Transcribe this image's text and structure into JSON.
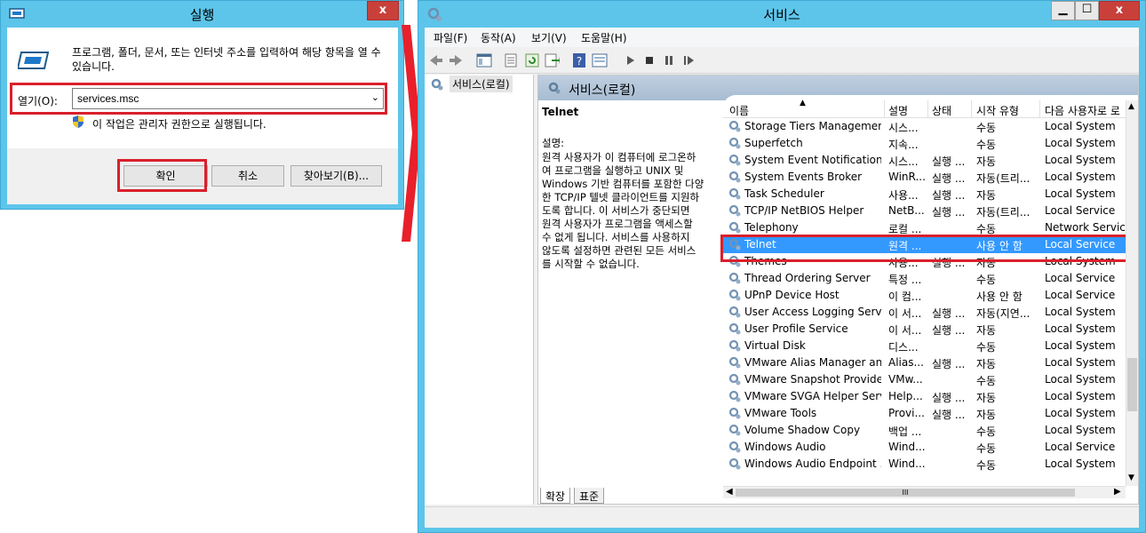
{
  "run": {
    "title": "실행",
    "close": "x",
    "description": "프로그램, 폴더, 문서, 또는 인터넷 주소를 입력하여 해당 항목을 열 수 있습니다.",
    "open_label": "열기(O):",
    "input_value": "services.msc",
    "admin_note": "이 작업은 관리자 권한으로 실행됩니다.",
    "ok": "확인",
    "cancel": "취소",
    "browse": "찾아보기(B)..."
  },
  "services": {
    "title": "서비스",
    "close": "x",
    "minimize": "▁",
    "maximize": "☐",
    "menu": [
      "파일(F)",
      "동작(A)",
      "보기(V)",
      "도움말(H)"
    ],
    "tree_item": "서비스(로컬)",
    "pane_title": "서비스(로컬)",
    "detail_name": "Telnet",
    "detail_label": "설명:",
    "detail_lines": [
      "원격 사용자가 이 컴퓨터에 로그온하",
      "여 프로그램을 실행하고 UNIX 및",
      "Windows 기반 컴퓨터를 포함한 다양",
      "한 TCP/IP 텔넷 클라이언트를 지원하",
      "도록 합니다. 이 서비스가 중단되면",
      "원격 사용자가 프로그램을 액세스할",
      "수 없게 됩니다. 서비스를 사용하지",
      "않도록 설정하면 관련된 모든 서비스",
      "를 시작할 수 없습니다."
    ],
    "columns": [
      "이름",
      "설명",
      "상태",
      "시작 유형",
      "다음 사용자로 로"
    ],
    "rows": [
      [
        "Storage Tiers Management",
        "시스...",
        "",
        "수동",
        "Local System"
      ],
      [
        "Superfetch",
        "지속...",
        "",
        "수동",
        "Local System"
      ],
      [
        "System Event Notification ...",
        "시스...",
        "실행 ...",
        "자동",
        "Local System"
      ],
      [
        "System Events Broker",
        "WinR...",
        "실행 ...",
        "자동(트리...",
        "Local System"
      ],
      [
        "Task Scheduler",
        "사용...",
        "실행 ...",
        "자동",
        "Local System"
      ],
      [
        "TCP/IP NetBIOS Helper",
        "NetB...",
        "실행 ...",
        "자동(트리...",
        "Local Service"
      ],
      [
        "Telephony",
        "로컬 ...",
        "",
        "수동",
        "Network Service"
      ],
      [
        "Telnet",
        "원격 ...",
        "",
        "사용 안 함",
        "Local Service"
      ],
      [
        "Themes",
        "사용...",
        "실행 ...",
        "자동",
        "Local System"
      ],
      [
        "Thread Ordering Server",
        "특정 ...",
        "",
        "수동",
        "Local Service"
      ],
      [
        "UPnP Device Host",
        "이 컴...",
        "",
        "사용 안 함",
        "Local Service"
      ],
      [
        "User Access Logging Service",
        "이 서...",
        "실행 ...",
        "자동(지연...",
        "Local System"
      ],
      [
        "User Profile Service",
        "이 서...",
        "실행 ...",
        "자동",
        "Local System"
      ],
      [
        "Virtual Disk",
        "디스...",
        "",
        "수동",
        "Local System"
      ],
      [
        "VMware Alias Manager an...",
        "Alias...",
        "실행 ...",
        "자동",
        "Local System"
      ],
      [
        "VMware Snapshot Provider",
        "VMw...",
        "",
        "수동",
        "Local System"
      ],
      [
        "VMware SVGA Helper Serv...",
        "Help...",
        "실행 ...",
        "자동",
        "Local System"
      ],
      [
        "VMware Tools",
        "Provi...",
        "실행 ...",
        "자동",
        "Local System"
      ],
      [
        "Volume Shadow Copy",
        "백업 ...",
        "",
        "수동",
        "Local System"
      ],
      [
        "Windows Audio",
        "Wind...",
        "",
        "수동",
        "Local Service"
      ],
      [
        "Windows Audio Endpoint ...",
        "Wind...",
        "",
        "수동",
        "Local System"
      ]
    ],
    "selected_index": 7,
    "tabs": [
      "확장",
      "표준"
    ],
    "hscroll_thumb": "III"
  },
  "colors": {
    "titlebar": "#5dc5ea",
    "close": "#c9403a",
    "highlight": "#d9202b",
    "selection": "#3399ff"
  }
}
